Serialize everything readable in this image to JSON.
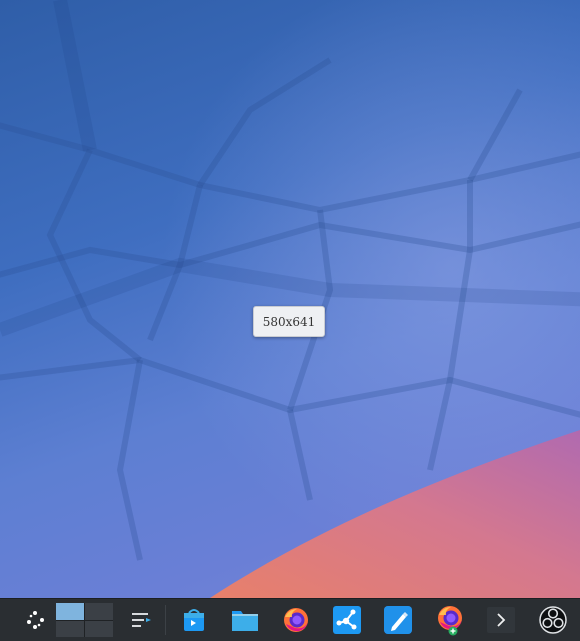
{
  "desktop": {
    "size_tooltip": "580x641",
    "colors": {
      "wallpaper_top": "#2f5ea8",
      "wallpaper_mid": "#5d7fd2",
      "wallpaper_accent_orange": "#e27a6c",
      "wallpaper_accent_pink": "#b66aa6"
    }
  },
  "panel": {
    "background": "#2a2e32",
    "pager": {
      "desktops": 4,
      "active_desktop": 1
    },
    "items": [
      {
        "id": "app-launcher",
        "icon": "app-launcher-icon"
      },
      {
        "id": "pager",
        "icon": "virtual-desktop-pager"
      },
      {
        "id": "task-manager-settings",
        "icon": "window-list-icon"
      },
      {
        "id": "discover",
        "icon": "discover-store-icon"
      },
      {
        "id": "dolphin",
        "icon": "folder-icon"
      },
      {
        "id": "firefox",
        "icon": "firefox-icon"
      },
      {
        "id": "kdeconnect",
        "icon": "share-network-icon"
      },
      {
        "id": "kate",
        "icon": "pen-editor-icon"
      },
      {
        "id": "firefox-new",
        "icon": "firefox-new-window-icon"
      },
      {
        "id": "console",
        "icon": "terminal-icon"
      },
      {
        "id": "obs",
        "icon": "obs-studio-icon"
      }
    ]
  }
}
